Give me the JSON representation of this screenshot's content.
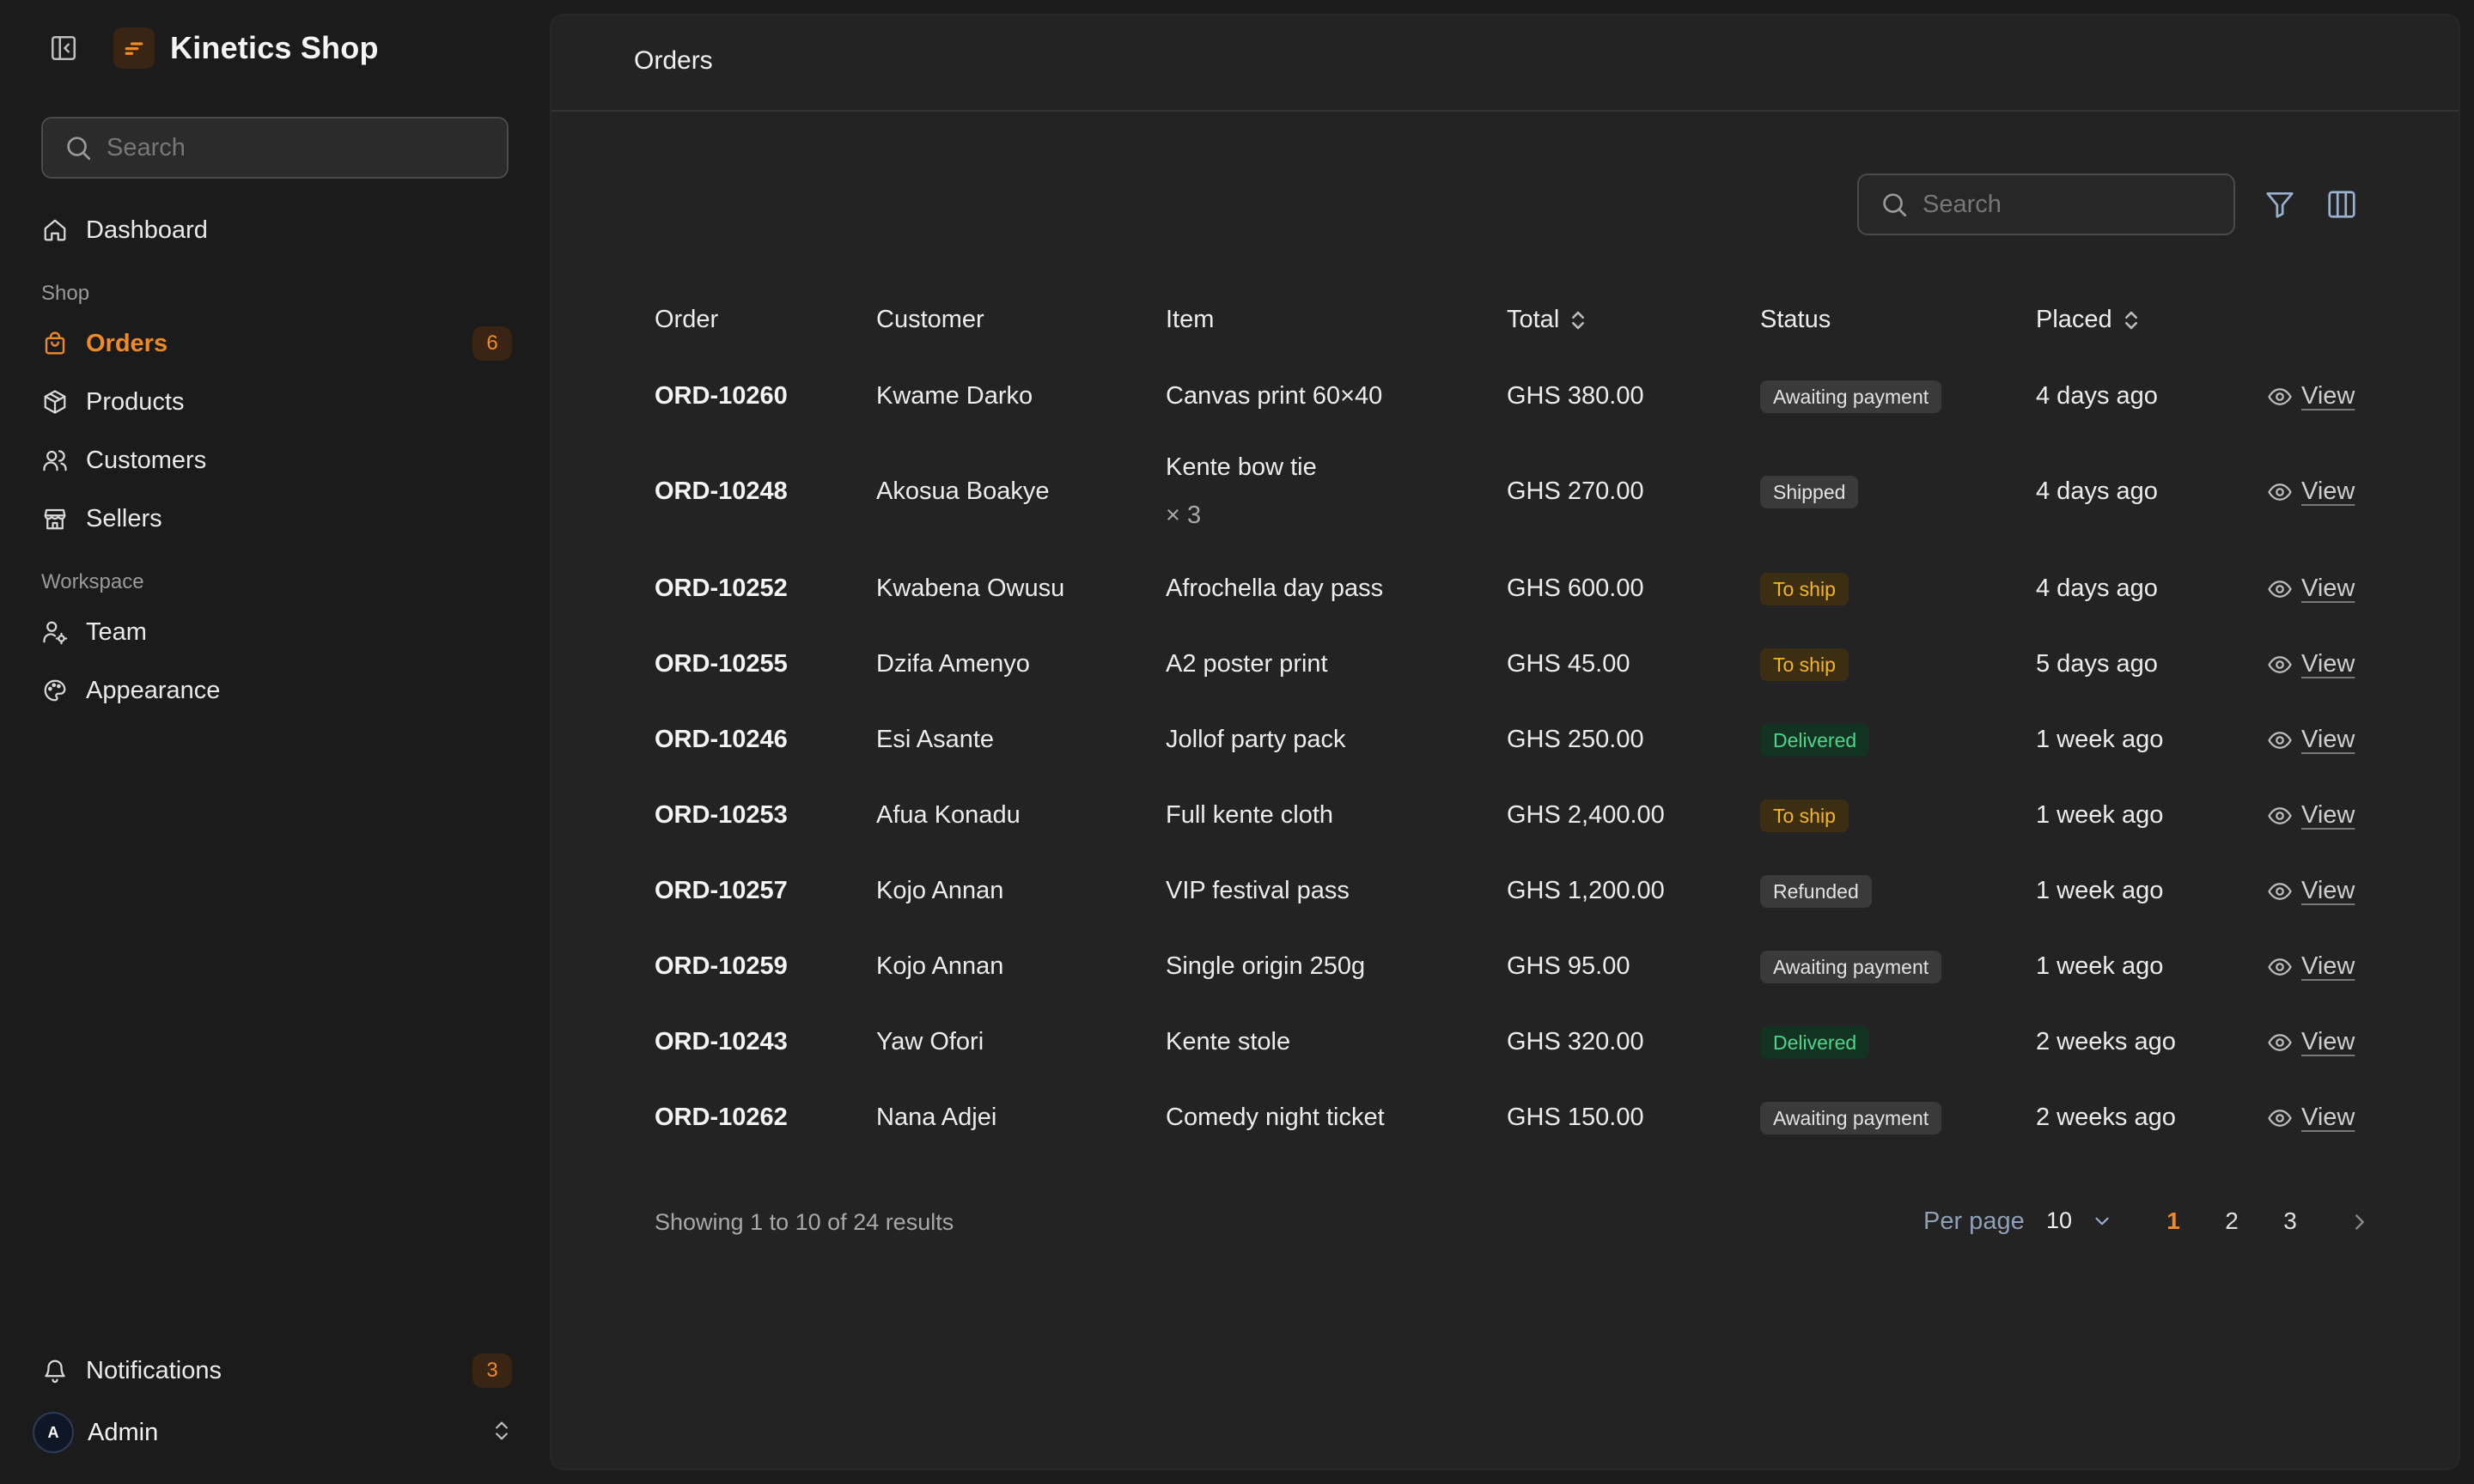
{
  "colors": {
    "accent": "#f08a24",
    "background": "#1b1b1b",
    "panel": "#232323"
  },
  "sidebar": {
    "brand": "Kinetics Shop",
    "search_placeholder": "Search",
    "dashboard": "Dashboard",
    "section_shop": "Shop",
    "orders": "Orders",
    "orders_badge": "6",
    "products": "Products",
    "customers": "Customers",
    "sellers": "Sellers",
    "section_workspace": "Workspace",
    "team": "Team",
    "appearance": "Appearance",
    "notifications": "Notifications",
    "notifications_badge": "3",
    "admin_initial": "A",
    "admin_name": "Admin"
  },
  "header": {
    "title": "Orders"
  },
  "toolbar": {
    "search_placeholder": "Search"
  },
  "table": {
    "columns": {
      "order": "Order",
      "customer": "Customer",
      "item": "Item",
      "total": "Total",
      "status": "Status",
      "placed": "Placed"
    },
    "view_label": "View",
    "rows": [
      {
        "order": "ORD-10260",
        "customer": "Kwame Darko",
        "item": "Canvas print 60×40",
        "item_sub": "",
        "total": "GHS 380.00",
        "status": "Awaiting payment",
        "status_kind": "neutral",
        "placed": "4 days ago"
      },
      {
        "order": "ORD-10248",
        "customer": "Akosua Boakye",
        "item": "Kente bow tie",
        "item_sub": "× 3",
        "total": "GHS 270.00",
        "status": "Shipped",
        "status_kind": "neutral",
        "placed": "4 days ago"
      },
      {
        "order": "ORD-10252",
        "customer": "Kwabena Owusu",
        "item": "Afrochella day pass",
        "item_sub": "",
        "total": "GHS 600.00",
        "status": "To ship",
        "status_kind": "toship",
        "placed": "4 days ago"
      },
      {
        "order": "ORD-10255",
        "customer": "Dzifa Amenyo",
        "item": "A2 poster print",
        "item_sub": "",
        "total": "GHS 45.00",
        "status": "To ship",
        "status_kind": "toship",
        "placed": "5 days ago"
      },
      {
        "order": "ORD-10246",
        "customer": "Esi Asante",
        "item": "Jollof party pack",
        "item_sub": "",
        "total": "GHS 250.00",
        "status": "Delivered",
        "status_kind": "delivered",
        "placed": "1 week ago"
      },
      {
        "order": "ORD-10253",
        "customer": "Afua Konadu",
        "item": "Full kente cloth",
        "item_sub": "",
        "total": "GHS 2,400.00",
        "status": "To ship",
        "status_kind": "toship",
        "placed": "1 week ago"
      },
      {
        "order": "ORD-10257",
        "customer": "Kojo Annan",
        "item": "VIP festival pass",
        "item_sub": "",
        "total": "GHS 1,200.00",
        "status": "Refunded",
        "status_kind": "neutral",
        "placed": "1 week ago"
      },
      {
        "order": "ORD-10259",
        "customer": "Kojo Annan",
        "item": "Single origin 250g",
        "item_sub": "",
        "total": "GHS 95.00",
        "status": "Awaiting payment",
        "status_kind": "neutral",
        "placed": "1 week ago"
      },
      {
        "order": "ORD-10243",
        "customer": "Yaw Ofori",
        "item": "Kente stole",
        "item_sub": "",
        "total": "GHS 320.00",
        "status": "Delivered",
        "status_kind": "delivered",
        "placed": "2 weeks ago"
      },
      {
        "order": "ORD-10262",
        "customer": "Nana Adjei",
        "item": "Comedy night ticket",
        "item_sub": "",
        "total": "GHS 150.00",
        "status": "Awaiting payment",
        "status_kind": "neutral",
        "placed": "2 weeks ago"
      }
    ]
  },
  "footer": {
    "showing": "Showing 1 to 10 of 24 results",
    "per_page_label": "Per page",
    "per_page_value": "10",
    "pages": [
      "1",
      "2",
      "3"
    ],
    "current_page": "1"
  }
}
